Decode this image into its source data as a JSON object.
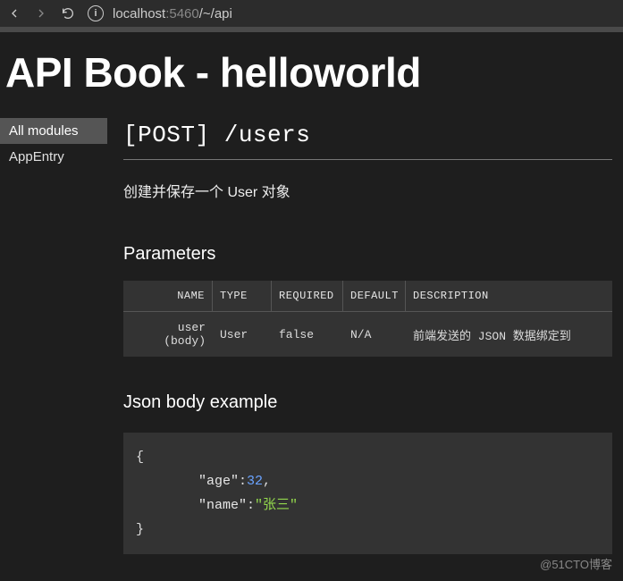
{
  "browser": {
    "url_host": "localhost",
    "url_port": ":5460",
    "url_path": "/~/api"
  },
  "header": {
    "title": "API Book - helloworld"
  },
  "sidebar": {
    "items": [
      {
        "label": "All modules",
        "active": true
      },
      {
        "label": "AppEntry",
        "active": false
      }
    ]
  },
  "endpoint": {
    "method": "[POST]",
    "path": " /users",
    "description": "创建并保存一个 User 对象"
  },
  "parameters": {
    "heading": "Parameters",
    "columns": {
      "name": "NAME",
      "type": "TYPE",
      "required": "REQUIRED",
      "default": "DEFAULT",
      "description": "DESCRIPTION"
    },
    "rows": [
      {
        "name": "user (body)",
        "type": "User",
        "required": "false",
        "default": "N/A",
        "description": "前端发送的 JSON 数据绑定到"
      }
    ]
  },
  "json_example": {
    "heading": "Json body example",
    "brace_open": "{",
    "brace_close": "}",
    "lines": [
      {
        "key": "\"age\"",
        "colon": ":",
        "value": "32",
        "value_kind": "num",
        "comma": ","
      },
      {
        "key": "\"name\"",
        "colon": ":",
        "value": "\"张三\"",
        "value_kind": "str",
        "comma": ""
      }
    ]
  },
  "watermark": "@51CTO博客"
}
